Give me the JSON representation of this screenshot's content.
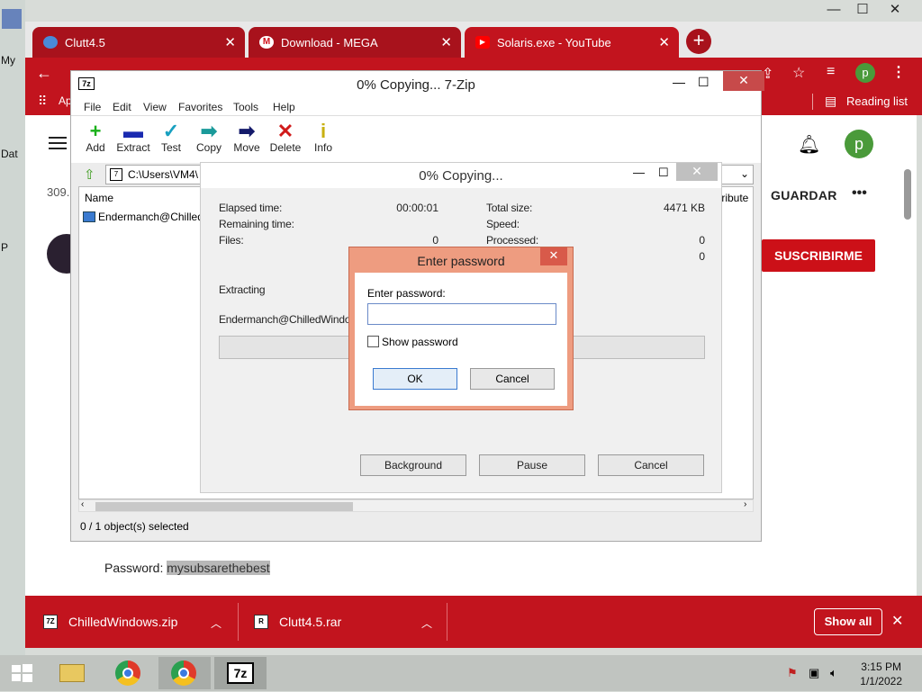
{
  "desktop": {
    "labels": [
      "My",
      "Dat",
      "P"
    ]
  },
  "chrome": {
    "tabs": [
      {
        "title": "Clutt4.5",
        "favicon_color": "#4a8ad8"
      },
      {
        "title": "Download - MEGA",
        "favicon_color": "#d0101a"
      },
      {
        "title": "Solaris.exe - YouTube",
        "favicon_color": "#ff0000"
      }
    ],
    "new_tab": "+",
    "window_controls": {
      "minimize": "—",
      "maximize": "☐",
      "close": "✕"
    },
    "address_fragment": "Ap",
    "bookmarks_apps": "Ap",
    "reading_list": "Reading list",
    "profile_letter": "p",
    "accent_color": "#c2141e"
  },
  "youtube": {
    "views": "309.",
    "save_label": "GUARDAR",
    "more": "•••",
    "subscribe": "SUSCRIBIRME",
    "profile_letter": "p",
    "password_label": "Password:",
    "password_value": "mysubsarethebest"
  },
  "zip": {
    "title": "0% Copying... 7-Zip",
    "logo": "7z",
    "menu": [
      "File",
      "Edit",
      "View",
      "Favorites",
      "Tools",
      "Help"
    ],
    "toolbar": [
      {
        "label": "Add",
        "icon": "+",
        "color": "#1ab01a"
      },
      {
        "label": "Extract",
        "icon": "▬",
        "color": "#1a2ab0"
      },
      {
        "label": "Test",
        "icon": "✓",
        "color": "#18a0c0"
      },
      {
        "label": "Copy",
        "icon": "➡",
        "color": "#1a9a9a"
      },
      {
        "label": "Move",
        "icon": "➡",
        "color": "#141a6a"
      },
      {
        "label": "Delete",
        "icon": "✕",
        "color": "#d01a1a"
      },
      {
        "label": "Info",
        "icon": "i",
        "color": "#c8b010"
      }
    ],
    "address": "C:\\Users\\VM4\\",
    "col_name": "Name",
    "col_attr": "tribute",
    "row": "Endermanch@Chilled",
    "status": "0 / 1 object(s) selected"
  },
  "copying": {
    "title": "0% Copying...",
    "elapsed_label": "Elapsed time:",
    "elapsed_value": "00:00:01",
    "remaining_label": "Remaining time:",
    "files_label": "Files:",
    "files_value": "0",
    "total_label": "Total size:",
    "total_value": "4471 KB",
    "speed_label": "Speed:",
    "processed_label": "Processed:",
    "processed_value": "0",
    "extra_value": "0",
    "extracting": "Extracting",
    "file": "Endermanch@ChilledWindows",
    "progress": 0,
    "background": "Background",
    "pause": "Pause",
    "cancel": "Cancel"
  },
  "password_dialog": {
    "title": "Enter password",
    "label": "Enter password:",
    "value": "",
    "show_password": "Show password",
    "show_checked": false,
    "ok": "OK",
    "cancel": "Cancel"
  },
  "downloads": {
    "items": [
      {
        "name": "ChilledWindows.zip",
        "icon": "7Z"
      },
      {
        "name": "Clutt4.5.rar",
        "icon": "R"
      }
    ],
    "show_all": "Show all"
  },
  "taskbar": {
    "time": "3:15 PM",
    "date": "1/1/2022",
    "zip_label": "7z"
  }
}
